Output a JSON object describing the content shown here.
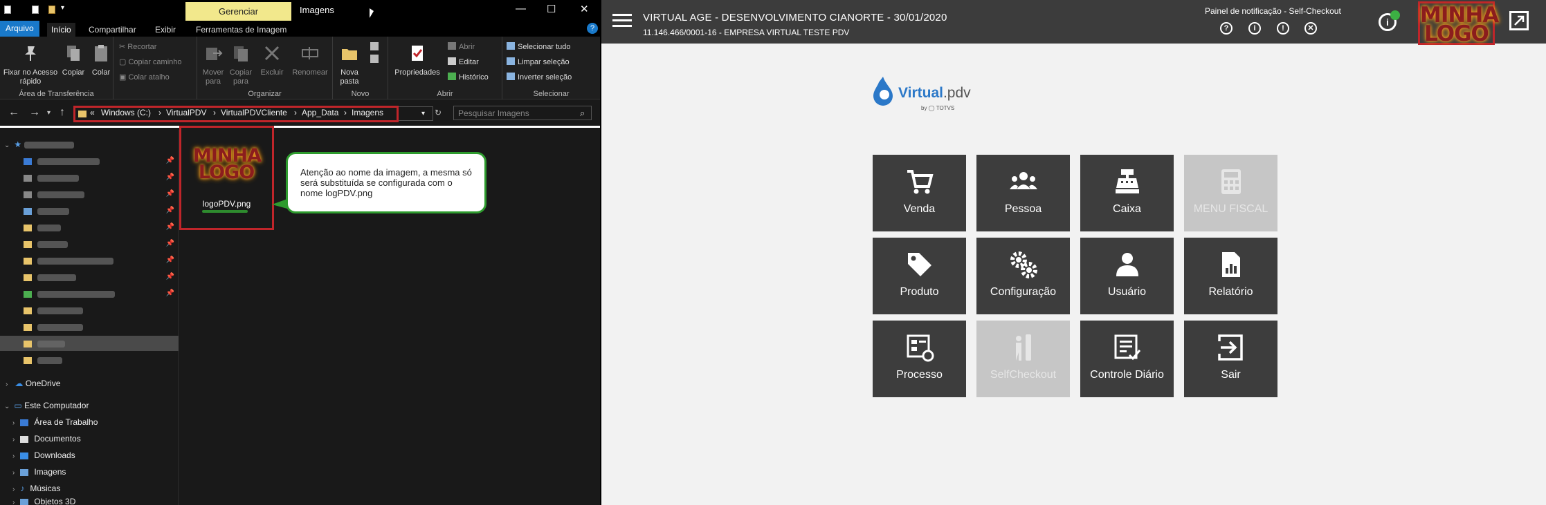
{
  "explorer": {
    "ribbon_tab_context": "Gerenciar",
    "window_title": "Imagens",
    "window_controls": [
      "—",
      "☐",
      "✕"
    ],
    "menu_tabs": [
      "Arquivo",
      "Início",
      "Compartilhar",
      "Exibir",
      "Ferramentas de Imagem"
    ],
    "ribbon": {
      "pin_label": "Fixar no Acesso rápido",
      "copy_label": "Copiar",
      "paste_label": "Colar",
      "cut_label": "Recortar",
      "copy_path_label": "Copiar caminho",
      "paste_shortcut_label": "Colar atalho",
      "group_clipboard": "Área de Transferência",
      "move_label": "Mover para",
      "copyto_label": "Copiar para",
      "delete_label": "Excluir",
      "rename_label": "Renomear",
      "group_organize": "Organizar",
      "newfolder_label": "Nova pasta",
      "group_new": "Novo",
      "properties_label": "Propriedades",
      "open_label": "Abrir",
      "edit_label": "Editar",
      "history_label": "Histórico",
      "group_open": "Abrir",
      "select_all_label": "Selecionar tudo",
      "clear_sel_label": "Limpar seleção",
      "invert_sel_label": "Inverter seleção",
      "group_select": "Selecionar"
    },
    "breadcrumb": [
      "«",
      "Windows (C:)",
      "VirtualPDV",
      "VirtualPDVCliente",
      "App_Data",
      "Imagens"
    ],
    "search_placeholder": "Pesquisar Imagens",
    "nav_items": [
      {
        "label": "OneDrive"
      },
      {
        "label": "Este Computador"
      },
      {
        "label": "Área de Trabalho"
      },
      {
        "label": "Documentos"
      },
      {
        "label": "Downloads"
      },
      {
        "label": "Imagens"
      },
      {
        "label": "Músicas"
      },
      {
        "label": "Objetos 3D"
      }
    ],
    "file": {
      "name": "logoPDV.png",
      "logo_line1": "MINHA",
      "logo_line2": "LOGO"
    },
    "callout_text": "Atenção ao nome da imagem, a mesma só será substituída se configurada com o nome logPDV.png"
  },
  "pdv": {
    "title": "VIRTUAL AGE - DESENVOLVIMENTO CIANORTE - 30/01/2020",
    "subtitle": "11.146.466/0001-16 - EMPRESA VIRTUAL TESTE PDV",
    "notification_panel": "Painel de notificação - Self-Checkout",
    "header_icons": [
      "?",
      "i",
      "!",
      "✕"
    ],
    "logo_line1": "MINHA",
    "logo_line2": "LOGO",
    "brand": {
      "name_bold": "Virtual",
      "name_suffix": ".pdv",
      "by": "by ◯ TOTVS"
    },
    "tiles": [
      {
        "label": "Venda",
        "icon": "cart-icon",
        "enabled": true
      },
      {
        "label": "Pessoa",
        "icon": "people-icon",
        "enabled": true
      },
      {
        "label": "Caixa",
        "icon": "cash-register-icon",
        "enabled": true
      },
      {
        "label": "MENU FISCAL",
        "icon": "calculator-icon",
        "enabled": false
      },
      {
        "label": "Produto",
        "icon": "tag-icon",
        "enabled": true
      },
      {
        "label": "Configuração",
        "icon": "gears-icon",
        "enabled": true
      },
      {
        "label": "Usuário",
        "icon": "user-icon",
        "enabled": true
      },
      {
        "label": "Relatório",
        "icon": "report-icon",
        "enabled": true
      },
      {
        "label": "Processo",
        "icon": "process-icon",
        "enabled": true
      },
      {
        "label": "SelfCheckout",
        "icon": "self-checkout-icon",
        "enabled": false
      },
      {
        "label": "Controle Diário",
        "icon": "daily-control-icon",
        "enabled": true
      },
      {
        "label": "Sair",
        "icon": "exit-icon",
        "enabled": true
      }
    ]
  }
}
